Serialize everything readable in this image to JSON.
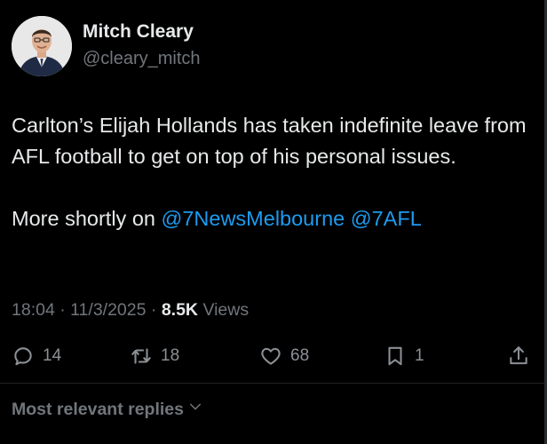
{
  "author": {
    "name": "Mitch Cleary",
    "handle": "@cleary_mitch"
  },
  "tweet": {
    "line1": "Carlton’s Elijah Hollands has taken indefinite leave from AFL football to get on top of his personal issues.",
    "line2_prefix": "More shortly on ",
    "mention1": "@7NewsMelbourne",
    "mention2": "@7AFL"
  },
  "meta": {
    "time": "18:04",
    "date": "11/3/2025",
    "views_count": "8.5K",
    "views_label": "Views"
  },
  "actions": {
    "replies": "14",
    "reposts": "18",
    "likes": "68",
    "bookmarks": "1"
  },
  "replies_sort": {
    "label": "Most relevant replies"
  },
  "icons": {
    "reply": "speech-bubble-icon",
    "repost": "repost-icon",
    "like": "heart-icon",
    "bookmark": "bookmark-icon",
    "share": "share-icon",
    "sort": "chevron-down-icon"
  },
  "colors": {
    "background": "#000000",
    "text": "#e7e9ea",
    "muted": "#71767b",
    "link": "#1d9bf0"
  }
}
